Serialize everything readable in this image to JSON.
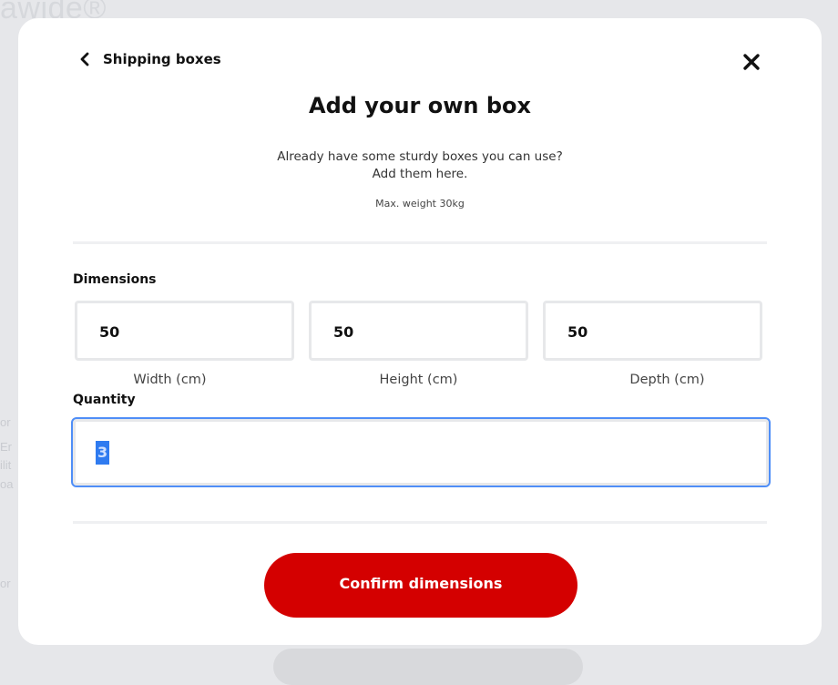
{
  "background": {
    "logo": "awide®",
    "fragments": [
      "or",
      "Er",
      "ilit",
      "oa",
      "or"
    ]
  },
  "modal": {
    "back_label": "Shipping boxes",
    "title": "Add your own box",
    "subtitle_line1": "Already have some sturdy boxes you can use?",
    "subtitle_line2": "Add them here.",
    "max_weight": "Max. weight 30kg",
    "dimensions_label": "Dimensions",
    "dimensions": {
      "width": {
        "value": "50",
        "caption": "Width (cm)"
      },
      "height": {
        "value": "50",
        "caption": "Height (cm)"
      },
      "depth": {
        "value": "50",
        "caption": "Depth (cm)"
      }
    },
    "quantity_label": "Quantity",
    "quantity_value": "3",
    "confirm_label": "Confirm dimensions"
  },
  "icons": {
    "back": "chevron-left-icon",
    "close": "close-icon"
  },
  "colors": {
    "accent": "#d40000",
    "focus": "#4f8ef7",
    "selection": "#2f7bf0"
  }
}
